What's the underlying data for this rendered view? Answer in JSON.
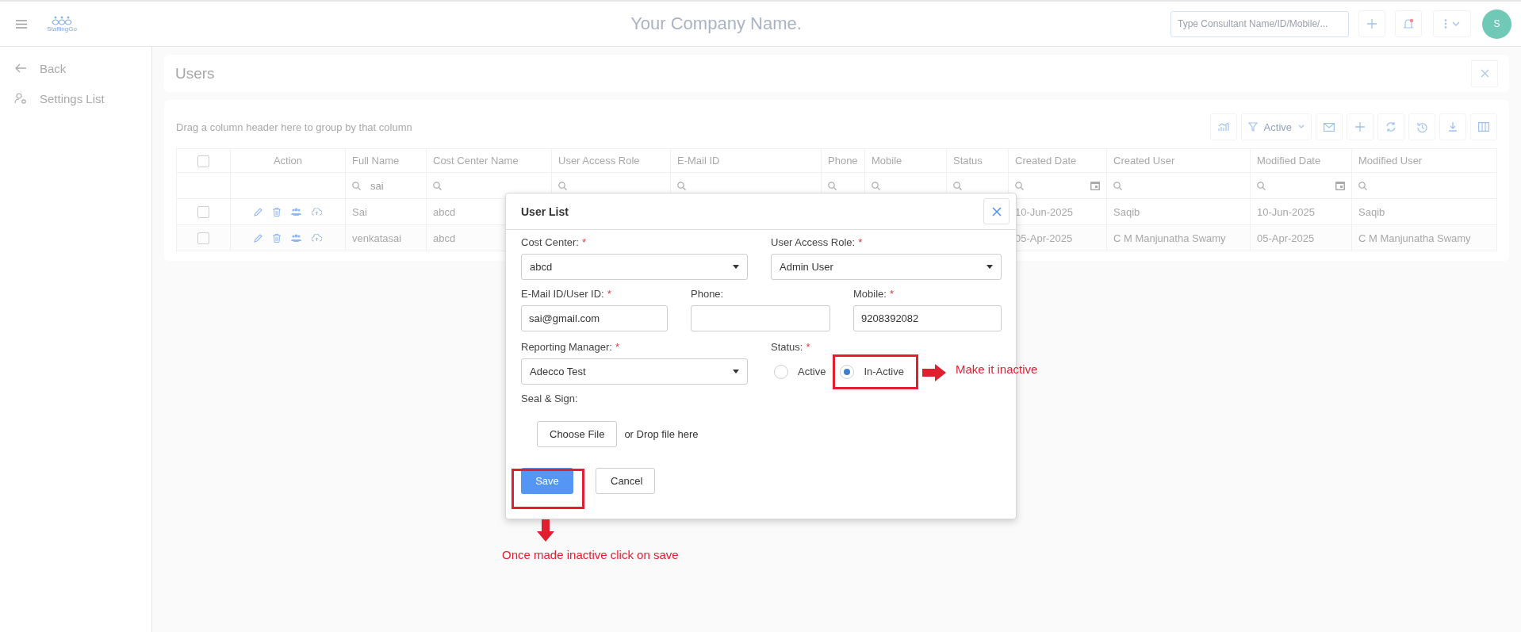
{
  "topbar": {
    "logo_text": "StaffingGo",
    "company_name": "Your Company Name.",
    "search": {
      "placeholder": "Type Consultant Name/ID/Mobile/..."
    },
    "avatar": "S"
  },
  "sidebar": {
    "items": [
      {
        "label": "Back",
        "kind": "back"
      },
      {
        "label": "Settings List",
        "kind": "settings"
      }
    ]
  },
  "page_title": "Users",
  "grid": {
    "group_hint": "Drag a column header here to group by that column",
    "status_filter": "Active",
    "header_checked": false,
    "columns": [
      {
        "label": "Action",
        "kind": "action"
      },
      {
        "label": "Full Name",
        "kind": "text",
        "value": "sai"
      },
      {
        "label": "Cost Center Name",
        "kind": "text"
      },
      {
        "label": "User Access Role",
        "kind": "text"
      },
      {
        "label": "E-Mail ID",
        "kind": "text"
      },
      {
        "label": "Phone",
        "kind": "text"
      },
      {
        "label": "Mobile",
        "kind": "text"
      },
      {
        "label": "Status",
        "kind": "text"
      },
      {
        "label": "Created Date",
        "kind": "date"
      },
      {
        "label": "Created User",
        "kind": "text"
      },
      {
        "label": "Modified Date",
        "kind": "date"
      },
      {
        "label": "Modified User",
        "kind": "text"
      }
    ],
    "rows": [
      {
        "checked": false,
        "full_name": "Sai",
        "cost_center": "abcd",
        "created_date": "10-Jun-2025",
        "created_user": "Saqib",
        "modified_date": "10-Jun-2025",
        "modified_user": "Saqib"
      },
      {
        "checked": false,
        "full_name": "venkatasai",
        "cost_center": "abcd",
        "created_date": "05-Apr-2025",
        "created_user": "C M Manjunatha Swamy",
        "modified_date": "05-Apr-2025",
        "modified_user": "C M Manjunatha Swamy"
      }
    ]
  },
  "dialog": {
    "title": "User List",
    "cost_center": {
      "label": "Cost Center:",
      "required_mark": "*",
      "value": "abcd"
    },
    "access_role": {
      "label": "User Access Role:",
      "required_mark": "*",
      "value": "Admin User"
    },
    "email": {
      "label": "E-Mail ID/User ID:",
      "required_mark": "*",
      "value": "sai@gmail.com"
    },
    "phone": {
      "label": "Phone:"
    },
    "mobile": {
      "label": "Mobile:",
      "required_mark": "*",
      "value": "9208392082"
    },
    "manager": {
      "label": "Reporting Manager:",
      "required_mark": "*",
      "value": "Adecco Test"
    },
    "status": {
      "label": "Status:",
      "required_mark": "*",
      "options": [
        {
          "label": "Active",
          "selected": false
        },
        {
          "label": "In-Active",
          "selected": true
        }
      ]
    },
    "seal_sign": {
      "label": "Seal & Sign:",
      "button": "Choose File",
      "hint": "or Drop file here"
    },
    "buttons": [
      {
        "label": "Save",
        "kind": "primary"
      },
      {
        "label": "Cancel",
        "kind": "secondary"
      }
    ]
  },
  "annotations": [
    {
      "kind": "status",
      "text": "Make it inactive"
    },
    {
      "kind": "save",
      "text": "Once made inactive click on save"
    }
  ]
}
